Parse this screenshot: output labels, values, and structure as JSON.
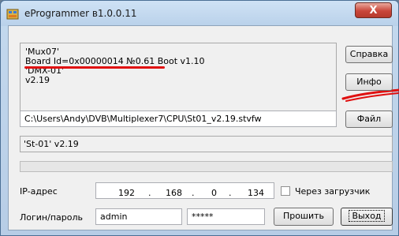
{
  "window": {
    "title": "eProgrammer в1.0.0.11",
    "close_label": "X"
  },
  "info_box": {
    "lines": [
      "'Mux07'",
      "Board Id=0x00000014 №0.61 Boot v1.10",
      "'DMX-01'",
      "v2.19"
    ]
  },
  "buttons": {
    "help": "Справка",
    "info": "Инфо",
    "file": "Файл",
    "flash": "Прошить",
    "exit": "Выход"
  },
  "file_path": "C:\\Users\\Andy\\DVB\\Multiplexer7\\CPU\\St01_v2.19.stvfw",
  "status_text": "'St-01' v2.19",
  "progress": 0,
  "ip": {
    "label": "IP-адрес",
    "octets": [
      "192",
      "168",
      "0",
      "134"
    ],
    "separator": "."
  },
  "bootloader": {
    "label": "Через загрузчик",
    "checked": false
  },
  "login": {
    "label": "Логин/пароль",
    "username": "admin",
    "password": "*****"
  },
  "colors": {
    "annotation": "#e01010",
    "title_bar": "#b9d1ea",
    "close_button": "#c9463a"
  }
}
